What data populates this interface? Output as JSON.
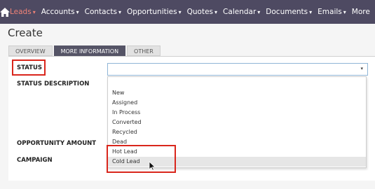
{
  "nav": {
    "items": [
      {
        "label": "Leads",
        "active": true
      },
      {
        "label": "Accounts",
        "active": false
      },
      {
        "label": "Contacts",
        "active": false
      },
      {
        "label": "Opportunities",
        "active": false
      },
      {
        "label": "Quotes",
        "active": false
      },
      {
        "label": "Calendar",
        "active": false
      },
      {
        "label": "Documents",
        "active": false
      },
      {
        "label": "Emails",
        "active": false
      }
    ],
    "more_label": "More",
    "caret": "▾"
  },
  "page": {
    "title": "Create",
    "tabs": [
      {
        "label": "OVERVIEW",
        "active": false
      },
      {
        "label": "MORE INFORMATION",
        "active": true
      },
      {
        "label": "OTHER",
        "active": false
      }
    ]
  },
  "form": {
    "status_label": "STATUS",
    "status_description_label": "STATUS DESCRIPTION",
    "opportunity_amount_label": "OPPORTUNITY AMOUNT",
    "campaign_label": "CAMPAIGN",
    "status_value": "",
    "status_options": [
      "New",
      "Assigned",
      "In Process",
      "Converted",
      "Recycled",
      "Dead",
      "Hot Lead",
      "Cold Lead"
    ],
    "hovered_option": "Cold Lead"
  },
  "colors": {
    "nav_bg": "#4e4a62",
    "nav_active": "#f08377",
    "highlight": "#d9261c"
  },
  "icons": {
    "home": "home-icon",
    "dropdown_arrow": "chevron-down-icon",
    "cursor": "mouse-pointer-icon"
  }
}
